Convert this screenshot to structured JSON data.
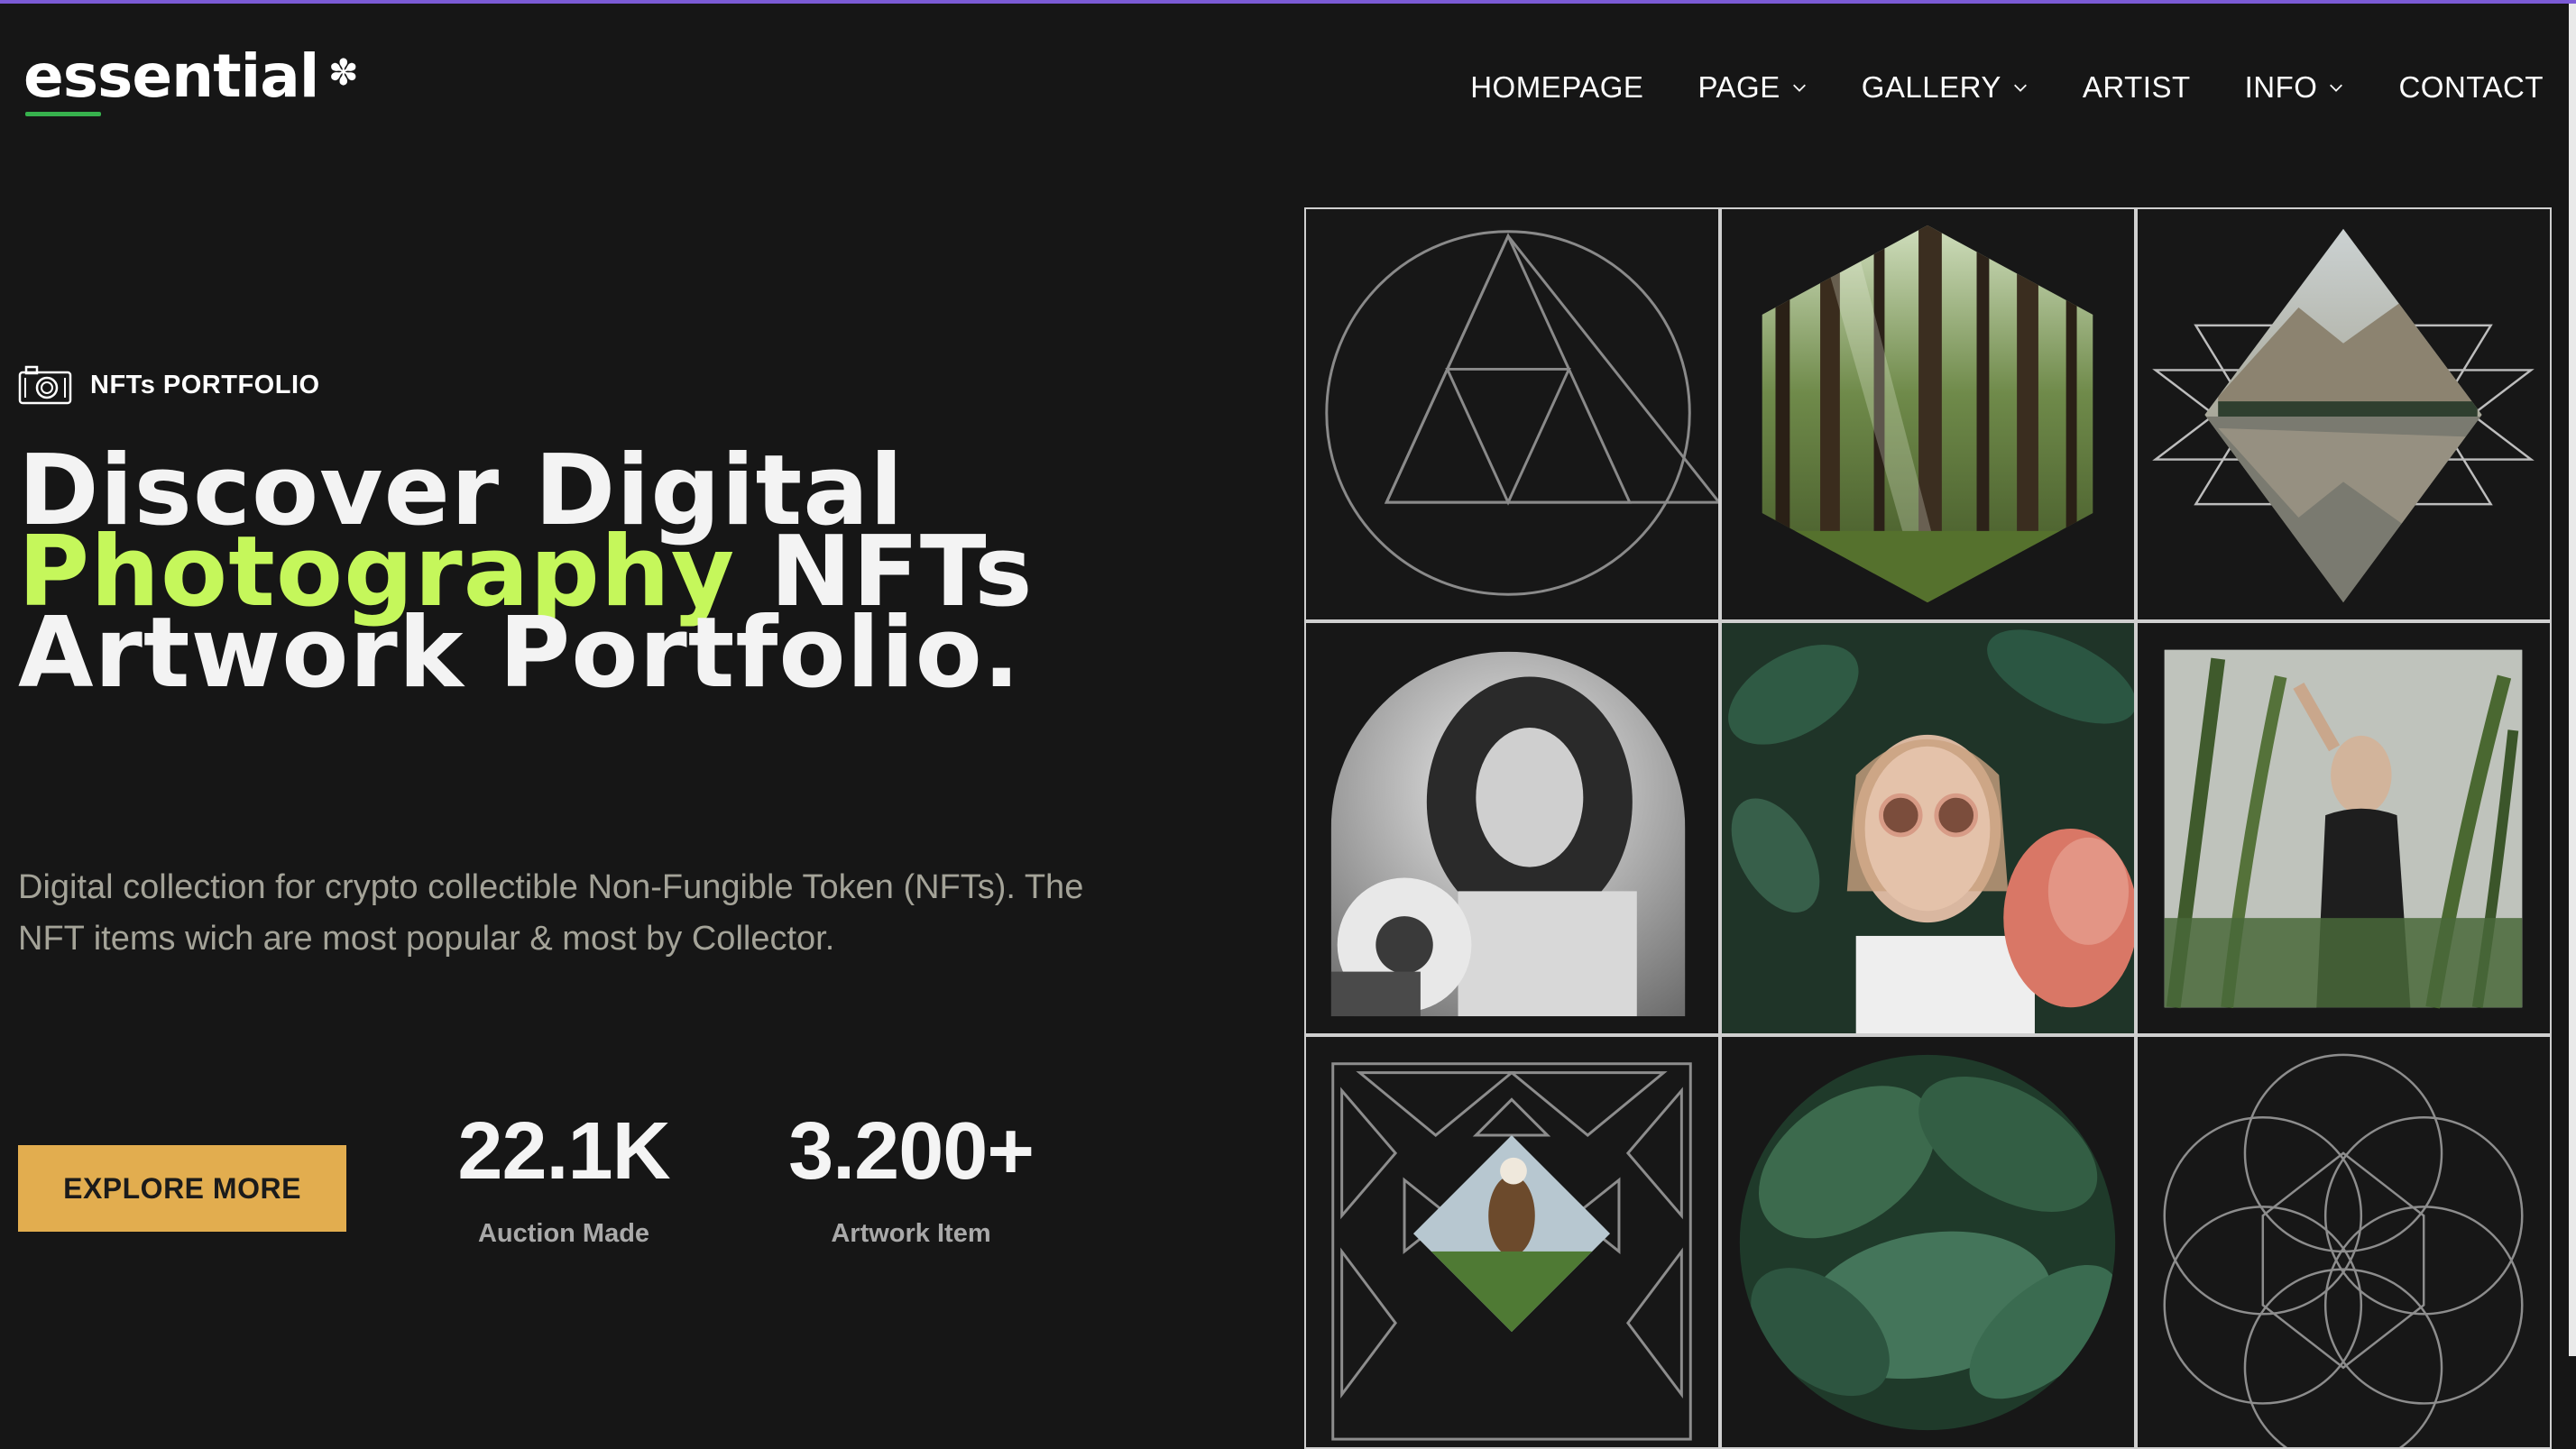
{
  "header": {
    "logo_text": "essential",
    "logo_mark": "✽",
    "nav": [
      {
        "label": "HOMEPAGE",
        "has_dropdown": false
      },
      {
        "label": "PAGE",
        "has_dropdown": true
      },
      {
        "label": "GALLERY",
        "has_dropdown": true
      },
      {
        "label": "ARTIST",
        "has_dropdown": false
      },
      {
        "label": "INFO",
        "has_dropdown": true
      },
      {
        "label": "CONTACT",
        "has_dropdown": false
      }
    ]
  },
  "hero": {
    "tag_icon": "camera-icon",
    "tag_label": "NFTs PORTFOLIO",
    "headline": {
      "line1": "Discover Digital",
      "line2_accent": "Photography",
      "line2_rest": " NFTs",
      "line3": "Artwork Portfolio."
    },
    "description": "Digital collection for crypto collectible Non-Fungible Token (NFTs). The NFT items wich are most popular & most by Collector.",
    "cta_label": "EXPLORE MORE",
    "stats": [
      {
        "value": "22.1K",
        "label": "Auction Made"
      },
      {
        "value": "3.200+",
        "label": "Artwork Item"
      }
    ]
  },
  "gallery": {
    "tiles": [
      "triangle-circle-pattern",
      "forest-hexagon-photo",
      "mountain-lake-diamond-photo",
      "woman-sunflower-arch-photo",
      "woman-sunglasses-leaves-photo",
      "woman-cornfield-photo",
      "bird-diamond-pattern-photo",
      "green-leaves-circle-photo",
      "flower-of-life-pattern"
    ]
  },
  "colors": {
    "background": "#161616",
    "accent_green": "#c5f75b",
    "button_gold": "#e2ad4f",
    "top_bar": "#7b5bd6",
    "logo_underline": "#37b24d"
  }
}
